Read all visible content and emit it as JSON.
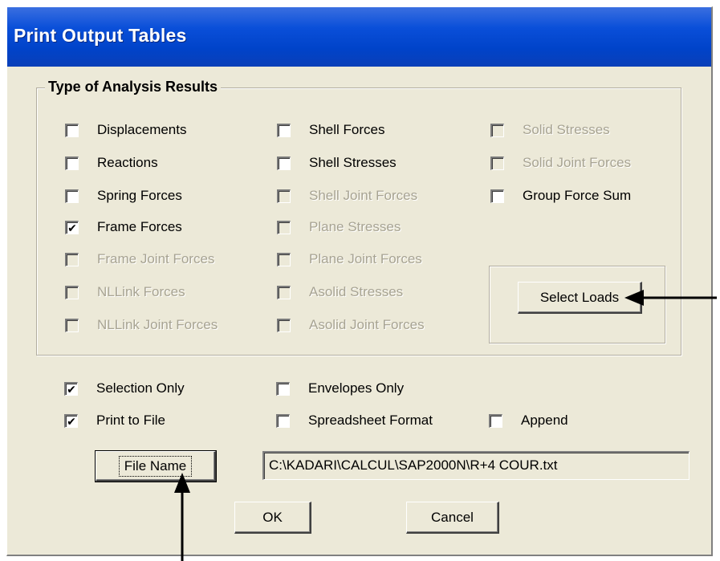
{
  "window": {
    "title": "Print Output Tables"
  },
  "group": {
    "legend": "Type of Analysis Results",
    "col1": [
      {
        "label": "Displacements",
        "checked": false,
        "enabled": true
      },
      {
        "label": "Reactions",
        "checked": false,
        "enabled": true
      },
      {
        "label": "Spring Forces",
        "checked": false,
        "enabled": true
      },
      {
        "label": "Frame Forces",
        "checked": true,
        "enabled": true
      },
      {
        "label": "Frame Joint Forces",
        "checked": false,
        "enabled": false
      },
      {
        "label": "NLLink Forces",
        "checked": false,
        "enabled": false
      },
      {
        "label": "NLLink Joint Forces",
        "checked": false,
        "enabled": false
      }
    ],
    "col2": [
      {
        "label": "Shell Forces",
        "checked": false,
        "enabled": true
      },
      {
        "label": "Shell Stresses",
        "checked": false,
        "enabled": true
      },
      {
        "label": "Shell Joint Forces",
        "checked": false,
        "enabled": false
      },
      {
        "label": "Plane Stresses",
        "checked": false,
        "enabled": false
      },
      {
        "label": "Plane Joint Forces",
        "checked": false,
        "enabled": false
      },
      {
        "label": "Asolid Stresses",
        "checked": false,
        "enabled": false
      },
      {
        "label": "Asolid Joint Forces",
        "checked": false,
        "enabled": false
      }
    ],
    "col3": [
      {
        "label": "Solid Stresses",
        "checked": false,
        "enabled": false
      },
      {
        "label": "Solid Joint Forces",
        "checked": false,
        "enabled": false
      },
      {
        "label": "Group Force Sum",
        "checked": false,
        "enabled": true
      }
    ],
    "select_loads_label": "Select Loads"
  },
  "options": {
    "selection_only": {
      "label": "Selection Only",
      "checked": true
    },
    "envelopes_only": {
      "label": "Envelopes Only",
      "checked": false
    },
    "print_to_file": {
      "label": "Print to File",
      "checked": true
    },
    "spreadsheet_format": {
      "label": "Spreadsheet Format",
      "checked": false
    },
    "append": {
      "label": "Append",
      "checked": false
    }
  },
  "file": {
    "button_label": "File Name",
    "path": "C:\\KADARI\\CALCUL\\SAP2000N\\R+4 COUR.txt"
  },
  "buttons": {
    "ok": "OK",
    "cancel": "Cancel"
  },
  "colors": {
    "title_bar": "#0a4fd9",
    "dialog_bg": "#ece9d8",
    "disabled_text": "#a7a392"
  },
  "check_glyph": "✔"
}
